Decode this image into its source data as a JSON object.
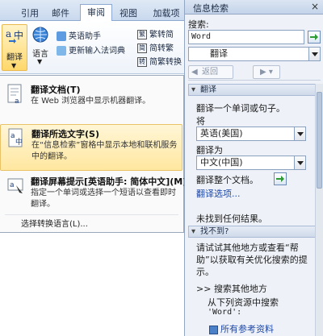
{
  "ribbon": {
    "tabs": [
      "引用",
      "邮件",
      "审阅",
      "视图",
      "加载项"
    ],
    "active_tab": "审阅",
    "translate_label": "翻译",
    "language_label": "语言",
    "assistant_label": "英语助手",
    "update_ime_label": "更新输入法词典",
    "trad_to_simp_label": "繁转简",
    "simp_to_trad_label": "简转繁",
    "conversion_label": "简繁转换"
  },
  "menu": {
    "items": [
      {
        "title": "翻译文档(T)",
        "desc": "在 Web 浏览器中显示机器翻译。"
      },
      {
        "title": "翻译所选文字(S)",
        "desc": "在“信息检索”窗格中显示本地和联机服务中的翻译。"
      },
      {
        "title": "翻译屏幕提示[英语助手: 简体中文](M)",
        "desc": "指定一个单词或选择一个短语以查看即时翻译。"
      }
    ],
    "footer": "选择转换语言(L)..."
  },
  "pane": {
    "title": "信息检索",
    "close": "×",
    "search_label": "搜索:",
    "search_value": "Word",
    "service_value": "翻译",
    "back_label": "返回",
    "section_translate": "翻译",
    "translate_hint": "翻译一个单词或句子。",
    "from_label": "将",
    "from_value": "英语(美国)",
    "to_label": "翻译为",
    "to_value": "中文(中国)",
    "translate_doc": "翻译整个文档。",
    "options_link": "翻译选项...",
    "no_results": "未找到任何结果。",
    "section_not_found": "找不到?",
    "help_text": "请试试其他地方或查看“帮助”以获取有关优化搜索的提示。",
    "search_elsewhere": "搜索其他地方",
    "from_resources": "从下列资源中搜索",
    "query_quoted": "'Word':",
    "all_refs": "所有参考资料"
  },
  "colors": {
    "highlight": "#ffe7a0",
    "link": "#1d47a8",
    "pane_bg": "#eef2f8"
  }
}
